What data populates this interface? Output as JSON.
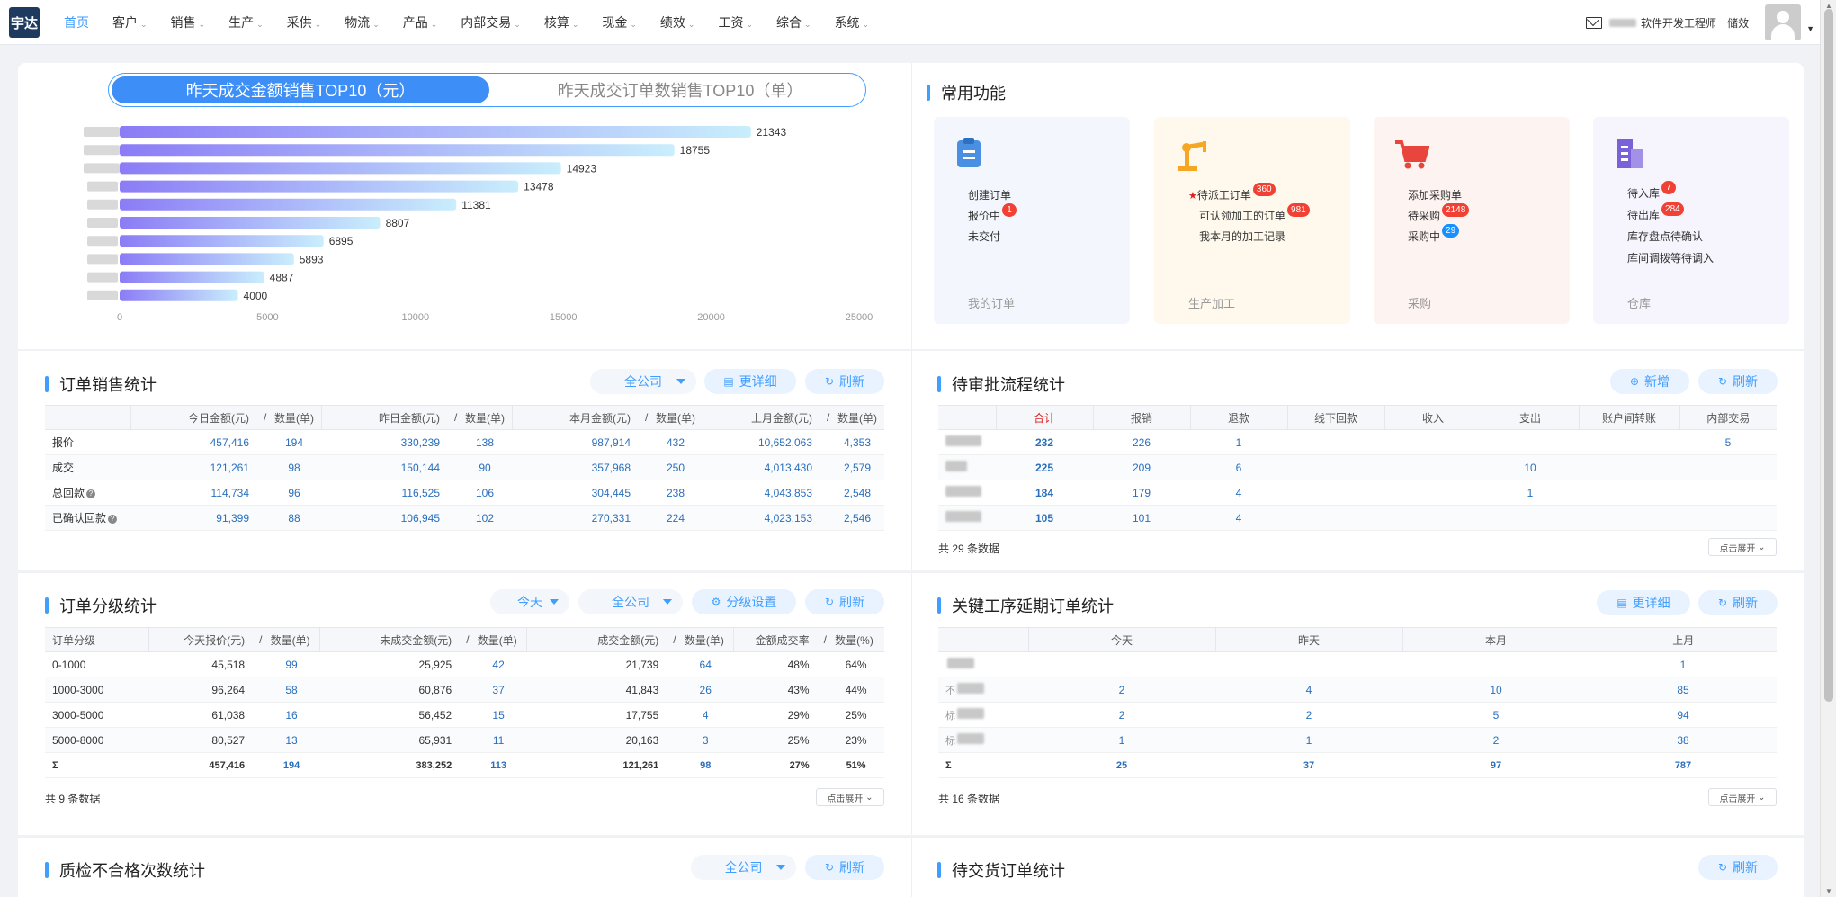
{
  "nav": {
    "logo": "宇达",
    "items": [
      {
        "label": "首页",
        "dropdown": false
      },
      {
        "label": "客户",
        "dropdown": true
      },
      {
        "label": "销售",
        "dropdown": true
      },
      {
        "label": "生产",
        "dropdown": true
      },
      {
        "label": "采供",
        "dropdown": true
      },
      {
        "label": "物流",
        "dropdown": true
      },
      {
        "label": "产品",
        "dropdown": true
      },
      {
        "label": "内部交易",
        "dropdown": true
      },
      {
        "label": "核算",
        "dropdown": true
      },
      {
        "label": "现金",
        "dropdown": true
      },
      {
        "label": "绩效",
        "dropdown": true
      },
      {
        "label": "工资",
        "dropdown": true
      },
      {
        "label": "综合",
        "dropdown": true
      },
      {
        "label": "系统",
        "dropdown": true
      }
    ],
    "role": "软件开发工程师",
    "user": "储效"
  },
  "top10": {
    "tab_amount": "昨天成交金额销售TOP10（元）",
    "tab_count": "昨天成交订单数销售TOP10（单）"
  },
  "chart_data": {
    "type": "bar",
    "orientation": "horizontal",
    "values": [
      21343,
      18755,
      14923,
      13478,
      11381,
      8807,
      6895,
      5893,
      4887,
      4000
    ],
    "xlim": [
      0,
      25000
    ],
    "xticks": [
      "0",
      "5000",
      "10000",
      "15000",
      "20000",
      "25000"
    ],
    "colors": {
      "start": "#8b7cf6",
      "end": "#c9eefc"
    }
  },
  "common": {
    "title": "常用功能",
    "cards": [
      {
        "name": "我的订单",
        "icon": "clipboard-icon",
        "bg": "#f3f7fd",
        "color": "#4a90e2",
        "lines": [
          {
            "text": "创建订单"
          },
          {
            "text": "报价中",
            "badge": "1"
          },
          {
            "text": "未交付"
          }
        ]
      },
      {
        "name": "生产加工",
        "icon": "robot-arm-icon",
        "bg": "#fef9ec",
        "color": "#f5a623",
        "lines": [
          {
            "text": "待派工订单",
            "badge": "360",
            "star": "★"
          },
          {
            "text": "可认领加工的订单",
            "badge": "981"
          },
          {
            "text": "我本月的加工记录"
          }
        ]
      },
      {
        "name": "采购",
        "icon": "cart-icon",
        "bg": "#fdf3f0",
        "color": "#e8453c",
        "lines": [
          {
            "text": "添加采购单"
          },
          {
            "text": "待采购",
            "badge": "2148"
          },
          {
            "text": "采购中",
            "badge": "29",
            "blue": true
          }
        ]
      },
      {
        "name": "仓库",
        "icon": "warehouse-icon",
        "bg": "#f6f5fd",
        "color": "#7b61d8",
        "lines": [
          {
            "text": "待入库",
            "badge": "7"
          },
          {
            "text": "待出库",
            "badge": "284"
          },
          {
            "text": "库存盘点待确认"
          },
          {
            "text": "库间调拨等待调入"
          }
        ]
      }
    ]
  },
  "order_sales": {
    "title": "订单销售统计",
    "company": "全公司",
    "detail": "更详细",
    "refresh": "刷新",
    "headers": [
      "",
      "今日金额(元)",
      "/",
      "数量(单)",
      "昨日金额(元)",
      "/",
      "数量(单)",
      "本月金额(元)",
      "/",
      "数量(单)",
      "上月金额(元)",
      "/",
      "数量(单)"
    ],
    "rows": [
      {
        "label": "报价",
        "q": false,
        "v": [
          "457,416",
          "194",
          "330,239",
          "138",
          "987,914",
          "432",
          "10,652,063",
          "4,353"
        ]
      },
      {
        "label": "成交",
        "q": false,
        "v": [
          "121,261",
          "98",
          "150,144",
          "90",
          "357,968",
          "250",
          "4,013,430",
          "2,579"
        ]
      },
      {
        "label": "总回款",
        "q": true,
        "v": [
          "114,734",
          "96",
          "116,525",
          "106",
          "304,445",
          "238",
          "4,043,853",
          "2,548"
        ]
      },
      {
        "label": "已确认回款",
        "q": true,
        "v": [
          "91,399",
          "88",
          "106,945",
          "102",
          "270,331",
          "224",
          "4,023,153",
          "2,546"
        ]
      }
    ]
  },
  "approval": {
    "title": "待审批流程统计",
    "add": "新增",
    "refresh": "刷新",
    "headers": [
      "",
      "合计",
      "报销",
      "退款",
      "线下回款",
      "收入",
      "支出",
      "账户间转账",
      "内部交易"
    ],
    "rows": [
      [
        "232",
        "226",
        "1",
        "",
        "",
        "",
        "",
        "5"
      ],
      [
        "225",
        "209",
        "6",
        "",
        "",
        "10",
        "",
        ""
      ],
      [
        "184",
        "179",
        "4",
        "",
        "",
        "1",
        "",
        ""
      ],
      [
        "105",
        "101",
        "4",
        "",
        "",
        "",
        "",
        ""
      ]
    ],
    "footer": "共 29 条数据",
    "expand": "点击展开"
  },
  "grade": {
    "title": "订单分级统计",
    "period": "今天",
    "company": "全公司",
    "settings": "分级设置",
    "refresh": "刷新",
    "headers": [
      "订单分级",
      "今天报价(元)",
      "/",
      "数量(单)",
      "未成交金额(元)",
      "/",
      "数量(单)",
      "成交金额(元)",
      "/",
      "数量(单)",
      "金额成交率",
      "/",
      "数量(%)"
    ],
    "rows": [
      [
        "0-1000",
        "45,518",
        "99",
        "25,925",
        "42",
        "21,739",
        "64",
        "48%",
        "64%"
      ],
      [
        "1000-3000",
        "96,264",
        "58",
        "60,876",
        "37",
        "41,843",
        "26",
        "43%",
        "44%"
      ],
      [
        "3000-5000",
        "61,038",
        "16",
        "56,452",
        "15",
        "17,755",
        "4",
        "29%",
        "25%"
      ],
      [
        "5000-8000",
        "80,527",
        "13",
        "65,931",
        "11",
        "20,163",
        "3",
        "25%",
        "23%"
      ]
    ],
    "total": [
      "Σ",
      "457,416",
      "194",
      "383,252",
      "113",
      "121,261",
      "98",
      "27%",
      "51%"
    ],
    "footer": "共 9 条数据",
    "expand": "点击展开"
  },
  "delay": {
    "title": "关键工序延期订单统计",
    "detail": "更详细",
    "refresh": "刷新",
    "headers": [
      "",
      "今天",
      "昨天",
      "本月",
      "上月"
    ],
    "rows": [
      [
        "",
        "",
        "",
        "1"
      ],
      [
        "2",
        "4",
        "10",
        "85"
      ],
      [
        "2",
        "2",
        "5",
        "94"
      ],
      [
        "1",
        "1",
        "2",
        "38"
      ]
    ],
    "row_prefix": [
      "",
      "不",
      "标",
      "标"
    ],
    "total": [
      "Σ",
      "25",
      "37",
      "97",
      "787"
    ],
    "footer": "共 16 条数据",
    "expand": "点击展开"
  },
  "quality": {
    "title": "质检不合格次数统计",
    "company": "全公司",
    "refresh": "刷新"
  },
  "delivery": {
    "title": "待交货订单统计",
    "refresh": "刷新"
  }
}
